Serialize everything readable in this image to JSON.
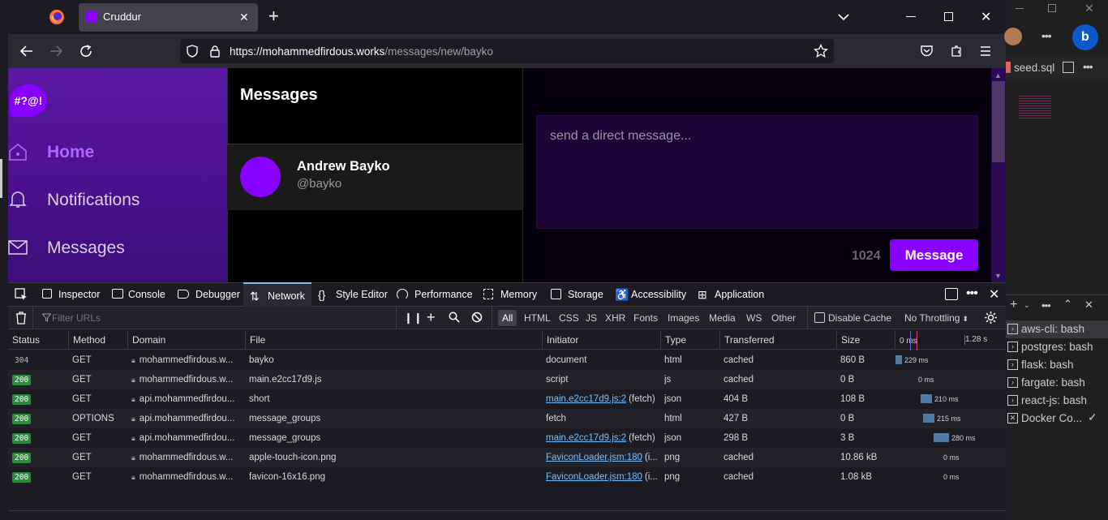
{
  "browser": {
    "tab_title": "Cruddur",
    "url_host": "https://mohammedfirdous.works",
    "url_path": "/messages/new/bayko"
  },
  "app": {
    "logo_text": "#?@!",
    "nav": [
      {
        "label": "Home",
        "active": true
      },
      {
        "label": "Notifications",
        "active": false
      },
      {
        "label": "Messages",
        "active": false
      }
    ],
    "messages_title": "Messages",
    "conversation": {
      "name": "Andrew Bayko",
      "handle": "@bayko"
    },
    "dm_placeholder": "send a direct message...",
    "char_count": "1024",
    "send_label": "Message",
    "accent_color": "#8800ff"
  },
  "devtools": {
    "tabs": [
      "Inspector",
      "Console",
      "Debugger",
      "Network",
      "Style Editor",
      "Performance",
      "Memory",
      "Storage",
      "Accessibility",
      "Application"
    ],
    "selected_tab": "Network",
    "filter_placeholder": "Filter URLs",
    "type_filters": [
      "All",
      "HTML",
      "CSS",
      "JS",
      "XHR",
      "Fonts",
      "Images",
      "Media",
      "WS",
      "Other"
    ],
    "disable_cache_label": "Disable Cache",
    "throttling": "No Throttling",
    "columns": [
      "Status",
      "Method",
      "Domain",
      "File",
      "Initiator",
      "Type",
      "Transferred",
      "Size"
    ],
    "waterfall_ticks": [
      "0 ms",
      "1.28 s"
    ],
    "rows": [
      {
        "status": "304",
        "method": "GET",
        "domain": "mohammedfirdous.w...",
        "file": "bayko",
        "initiator": "document",
        "initiator_link": false,
        "type": "html",
        "transferred": "cached",
        "size": "860 B",
        "timing": "229 ms"
      },
      {
        "status": "200",
        "method": "GET",
        "domain": "mohammedfirdous.w...",
        "file": "main.e2cc17d9.js",
        "initiator": "script",
        "initiator_link": false,
        "type": "js",
        "transferred": "cached",
        "size": "0 B",
        "timing": "0 ms"
      },
      {
        "status": "200",
        "method": "GET",
        "domain": "api.mohammedfirdou...",
        "file": "short",
        "initiator": "main.e2cc17d9.js:2",
        "initiator_suffix": "(fetch)",
        "initiator_link": true,
        "type": "json",
        "transferred": "404 B",
        "size": "108 B",
        "timing": "210 ms"
      },
      {
        "status": "200",
        "method": "OPTIONS",
        "domain": "api.mohammedfirdou...",
        "file": "message_groups",
        "initiator": "fetch",
        "initiator_link": false,
        "type": "html",
        "transferred": "427 B",
        "size": "0 B",
        "timing": "215 ms"
      },
      {
        "status": "200",
        "method": "GET",
        "domain": "api.mohammedfirdou...",
        "file": "message_groups",
        "initiator": "main.e2cc17d9.js:2",
        "initiator_suffix": "(fetch)",
        "initiator_link": true,
        "type": "json",
        "transferred": "298 B",
        "size": "3 B",
        "timing": "280 ms"
      },
      {
        "status": "200",
        "method": "GET",
        "domain": "mohammedfirdous.w...",
        "file": "apple-touch-icon.png",
        "initiator": "FaviconLoader.jsm:180",
        "initiator_suffix": "(i...",
        "initiator_link": true,
        "type": "png",
        "transferred": "cached",
        "size": "10.86 kB",
        "timing": "0 ms"
      },
      {
        "status": "200",
        "method": "GET",
        "domain": "mohammedfirdous.w...",
        "file": "favicon-16x16.png",
        "initiator": "FaviconLoader.jsm:180",
        "initiator_suffix": "(i...",
        "initiator_link": true,
        "type": "png",
        "transferred": "cached",
        "size": "1.08 kB",
        "timing": "0 ms"
      }
    ]
  },
  "vscode": {
    "tab_file": "seed.sql",
    "terminals": [
      "aws-cli: bash",
      "postgres: bash",
      "flask: bash",
      "fargate: bash",
      "react-js: bash",
      "Docker Co..."
    ]
  }
}
